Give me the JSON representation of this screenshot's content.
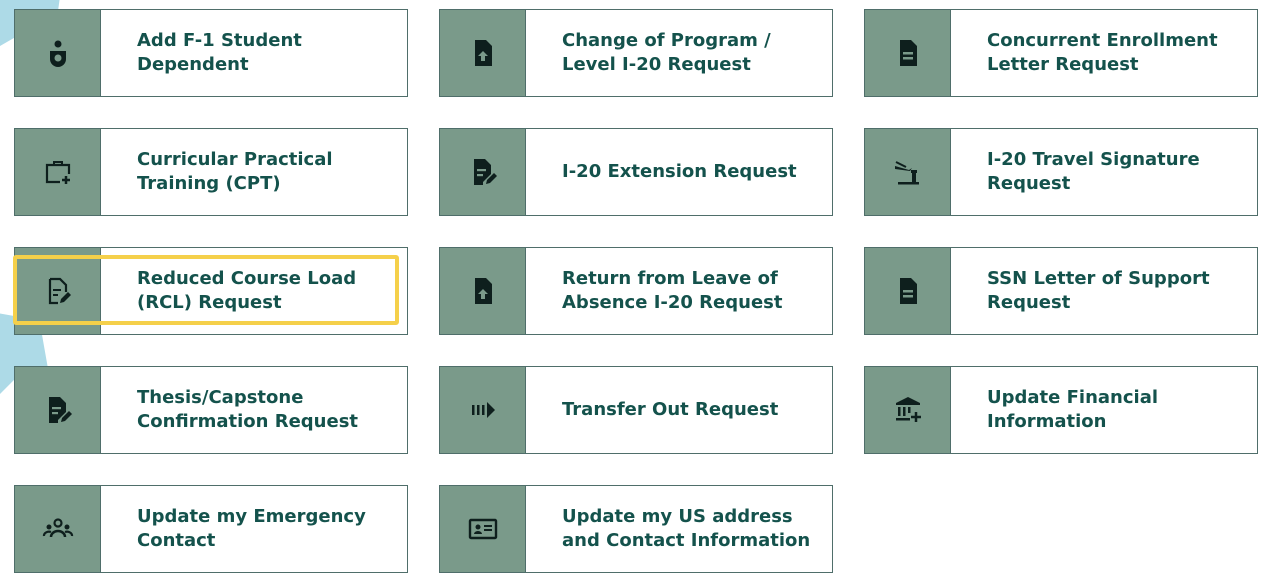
{
  "colors": {
    "icon_bg": "#7a9a8a",
    "border": "#4f6e6a",
    "label_text": "#14524c",
    "highlight": "#f5d04a",
    "arrow": "#a9d8e6"
  },
  "cards": [
    {
      "label": "Add F-1 Student\nDependent",
      "icon": "person-icon"
    },
    {
      "label": "Change of Program /\nLevel I-20 Request",
      "icon": "file-upload-icon"
    },
    {
      "label": "Concurrent Enrollment\nLetter Request",
      "icon": "document-icon"
    },
    {
      "label": "Curricular Practical\nTraining (CPT)",
      "icon": "briefcase-plus-icon"
    },
    {
      "label": "I-20 Extension Request",
      "icon": "document-edit-icon"
    },
    {
      "label": "I-20 Travel Signature\nRequest",
      "icon": "airplane-tower-icon"
    },
    {
      "label": "Reduced Course Load\n(RCL) Request",
      "icon": "document-edit-outline-icon",
      "highlighted": true
    },
    {
      "label": "Return from Leave of\nAbsence I-20 Request",
      "icon": "file-upload-icon"
    },
    {
      "label": "SSN Letter of Support\nRequest",
      "icon": "document-icon"
    },
    {
      "label": "Thesis/Capstone\nConfirmation Request",
      "icon": "document-edit-icon"
    },
    {
      "label": "Transfer Out Request",
      "icon": "transfer-arrow-icon"
    },
    {
      "label": "Update Financial\nInformation",
      "icon": "bank-plus-icon"
    },
    {
      "label": "Update my Emergency\nContact",
      "icon": "group-icon"
    },
    {
      "label": "Update my US address\nand Contact Information",
      "icon": "id-card-icon"
    }
  ]
}
